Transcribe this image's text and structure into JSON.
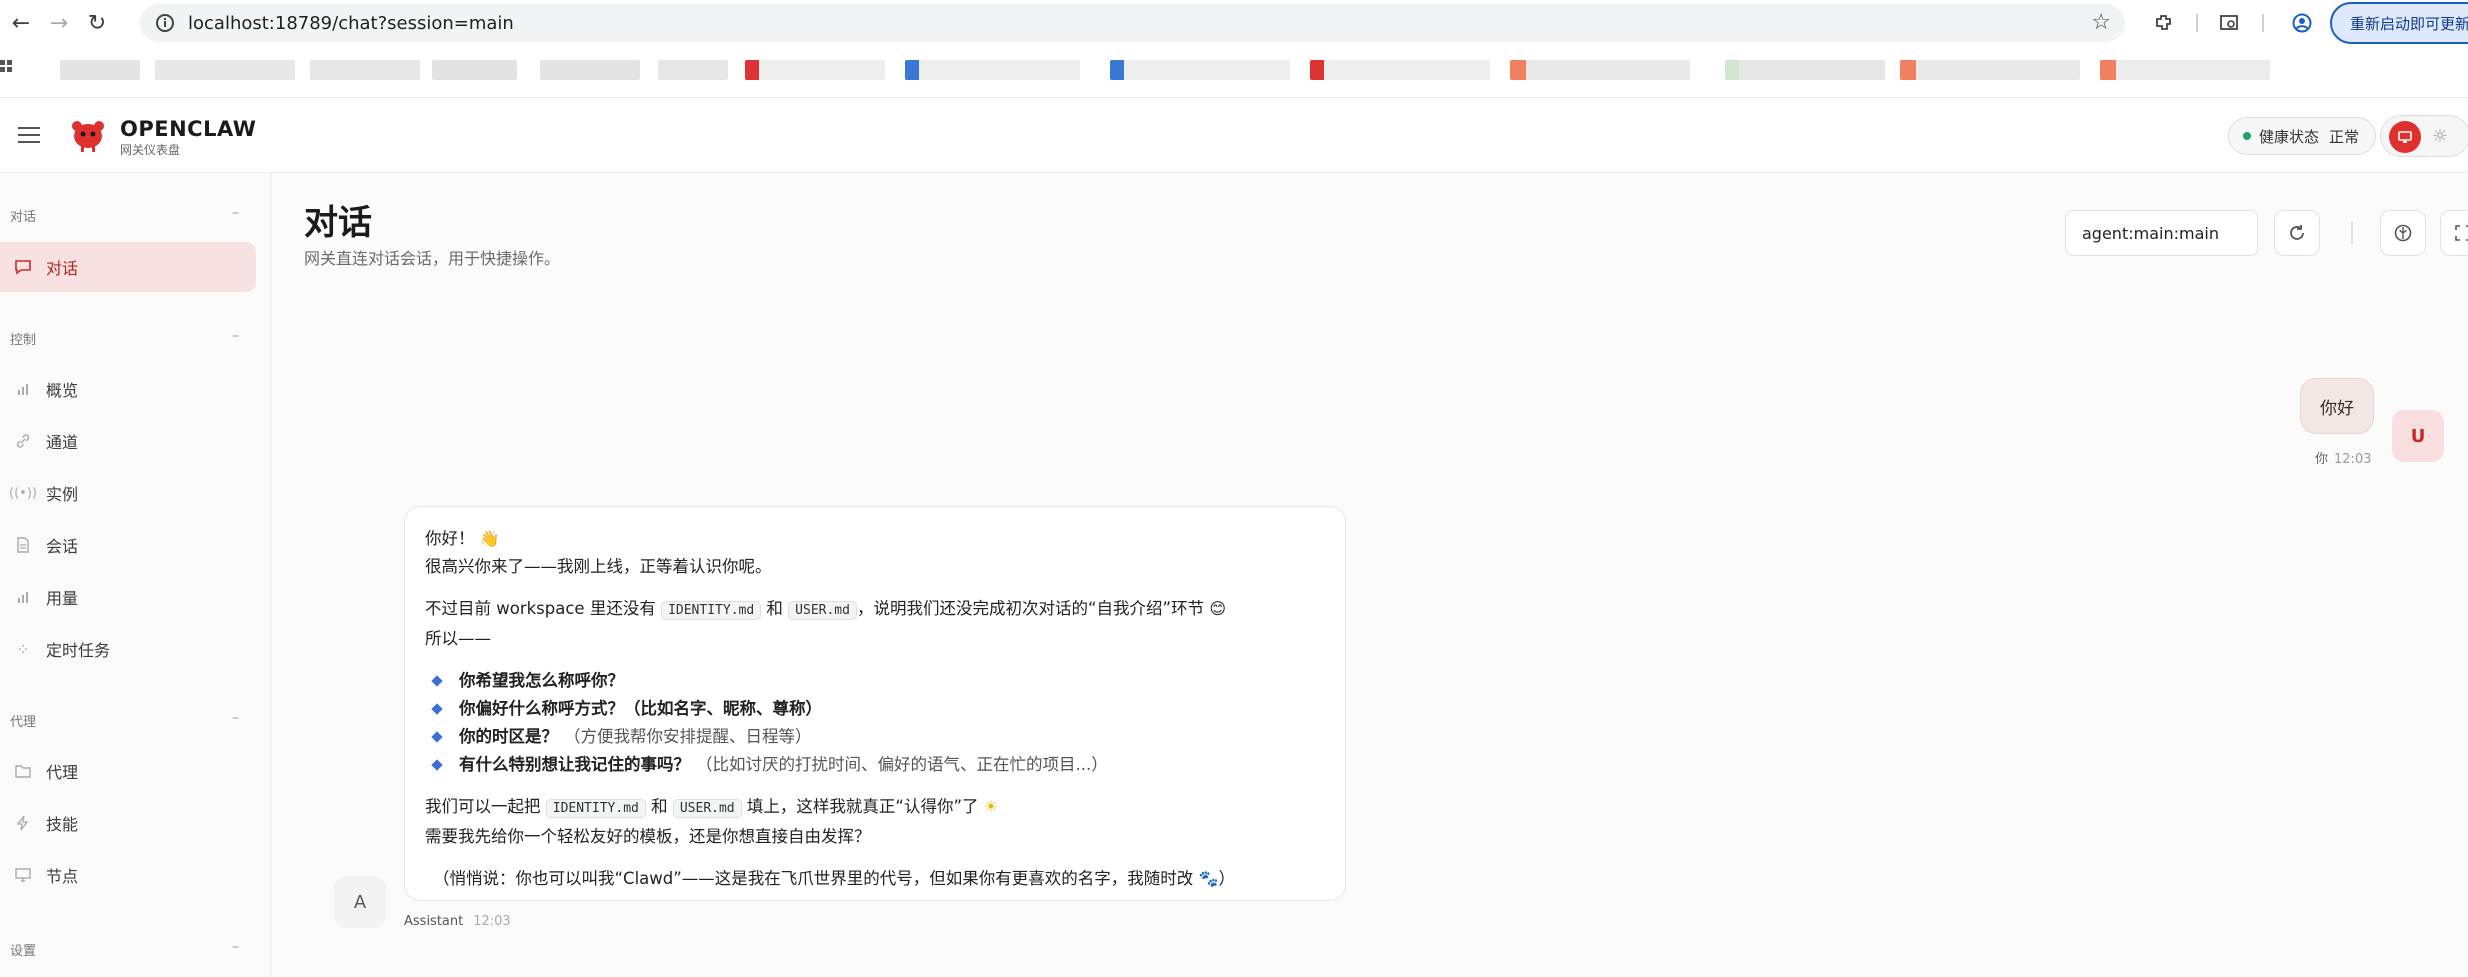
{
  "browser": {
    "url": "localhost:18789/chat?session=main",
    "restart_label": "重新启动即可更新"
  },
  "header": {
    "brand_name": "OPENCLAW",
    "brand_sub": "网关仪表盘",
    "health_label": "健康状态",
    "health_value": "正常"
  },
  "sidebar": {
    "sections": [
      {
        "title": "对话",
        "items": [
          {
            "label": "对话",
            "icon": "chat-icon",
            "active": true
          }
        ]
      },
      {
        "title": "控制",
        "items": [
          {
            "label": "概览",
            "icon": "bar-chart-icon"
          },
          {
            "label": "通道",
            "icon": "link-icon"
          },
          {
            "label": "实例",
            "icon": "broadcast-icon"
          },
          {
            "label": "会话",
            "icon": "document-icon"
          },
          {
            "label": "用量",
            "icon": "bar-chart-icon"
          },
          {
            "label": "定时任务",
            "icon": "loader-icon"
          }
        ]
      },
      {
        "title": "代理",
        "items": [
          {
            "label": "代理",
            "icon": "folder-icon"
          },
          {
            "label": "技能",
            "icon": "lightning-icon"
          },
          {
            "label": "节点",
            "icon": "monitor-icon"
          }
        ]
      },
      {
        "title": "设置",
        "items": []
      }
    ],
    "collapse_symbol": "–"
  },
  "main": {
    "title": "对话",
    "subtitle": "网关直连对话会话，用于快捷操作。",
    "session_key": "agent:main:main"
  },
  "messages": {
    "user": {
      "text": "你好",
      "sender": "你",
      "time": "12:03",
      "avatar": "U"
    },
    "assistant": {
      "avatar": "A",
      "sender": "Assistant",
      "time": "12:03",
      "line1": "你好！",
      "line2": "很高兴你来了——我刚上线，正等着认识你呢。",
      "line3_a": "不过目前 workspace 里还没有",
      "code1": "IDENTITY.md",
      "and1": "和",
      "code2": "USER.md",
      "line3_b": "，说明我们还没完成初次对话的“自我介绍”环节",
      "line4": "所以——",
      "bullets": [
        {
          "bold": "你希望我怎么称呼你？",
          "note": ""
        },
        {
          "bold": "你偏好什么称呼方式？（比如名字、昵称、尊称）",
          "note": ""
        },
        {
          "bold": "你的时区是？",
          "note": "（方便我帮你安排提醒、日程等）"
        },
        {
          "bold": "有什么特别想让我记住的事吗？",
          "note": "（比如讨厌的打扰时间、偏好的语气、正在忙的项目...）"
        }
      ],
      "line5_a": "我们可以一起把",
      "code3": "IDENTITY.md",
      "and2": "和",
      "code4": "USER.md",
      "line5_b": "填上，这样我就真正“认得你”了",
      "line6": "需要我先给你一个轻松友好的模板，还是你想直接自由发挥？",
      "line7": "（悄悄说：你也可以叫我“Clawd”——这是我在飞爪世界里的代号，但如果你有更喜欢的名字，我随时改",
      "line7_end": "）"
    }
  }
}
